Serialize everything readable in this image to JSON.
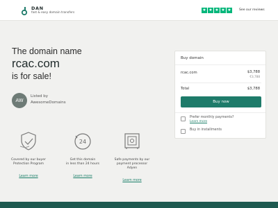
{
  "header": {
    "logo_name": "DAN",
    "logo_tagline": "fast & easy domain transfers",
    "reviews_label": "See our reviews",
    "star_color": "#00b67a"
  },
  "hero": {
    "line1": "The domain name",
    "domain": "rcac.com",
    "line3": "is for sale!"
  },
  "seller": {
    "avatar_initials": "AW",
    "listed_by": "Listed by",
    "name": "AwesomeDomains"
  },
  "features": [
    {
      "icon": "shield-hand-icon",
      "text_line1": "Covered by our buyer",
      "text_line2": "Protection Program",
      "link": "Learn more"
    },
    {
      "icon": "clock-24-icon",
      "text_line1": "Get this domain",
      "text_line2": "in less than 24 hours",
      "link": "Learn more"
    },
    {
      "icon": "safe-icon",
      "text_line1": "Safe payments by our",
      "text_line2": "payment processor",
      "text_line3": "Adyen",
      "link": "Learn more"
    }
  ],
  "card": {
    "title": "Buy domain",
    "domain_label": "rcac.com",
    "price": "$3,788",
    "price_sub": "€3,788",
    "total_label": "Total",
    "total_value": "$3,788",
    "buy_button": "Buy now",
    "option1_text": "Prefer monthly payments?",
    "option1_link": "Learn more",
    "option2_text": "Buy in installments"
  },
  "colors": {
    "accent": "#1e7b6a",
    "footer": "#1e5a50",
    "background": "#f1f1ef"
  }
}
